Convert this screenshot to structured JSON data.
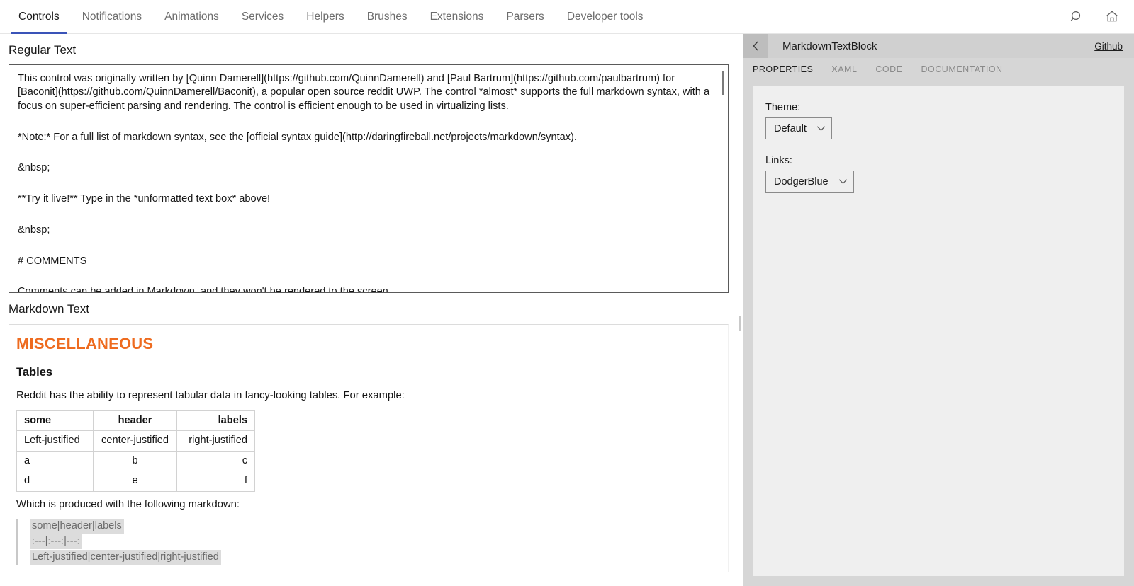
{
  "colors": {
    "accent": "#3a53b8",
    "markdown_heading": "#ee6b1f"
  },
  "topbar": {
    "tabs": [
      {
        "label": "Controls",
        "active": true
      },
      {
        "label": "Notifications",
        "active": false
      },
      {
        "label": "Animations",
        "active": false
      },
      {
        "label": "Services",
        "active": false
      },
      {
        "label": "Helpers",
        "active": false
      },
      {
        "label": "Brushes",
        "active": false
      },
      {
        "label": "Extensions",
        "active": false
      },
      {
        "label": "Parsers",
        "active": false
      },
      {
        "label": "Developer tools",
        "active": false
      }
    ],
    "search_icon": "search-icon",
    "home_icon": "home-icon"
  },
  "left": {
    "regular_text_label": "Regular Text",
    "markdown_text_label": "Markdown Text",
    "editor_paragraphs": [
      "This control was originally written by [Quinn Damerell](https://github.com/QuinnDamerell) and [Paul Bartrum](https://github.com/paulbartrum) for [Baconit](https://github.com/QuinnDamerell/Baconit), a popular open source reddit UWP. The control *almost* supports the full markdown syntax, with a focus on super-efficient parsing and rendering. The control is efficient enough to be used in virtualizing lists.",
      "*Note:* For a full list of markdown syntax, see the [official syntax guide](http://daringfireball.net/projects/markdown/syntax).",
      "&nbsp;",
      "**Try it live!** Type in the *unformatted text box* above!",
      "&nbsp;",
      "# COMMENTS",
      "Comments can be added in Markdown, and they won't be rendered to the screen."
    ],
    "rendered": {
      "h1": "MISCELLANEOUS",
      "h2": "Tables",
      "intro": "Reddit has the ability to represent tabular data in fancy-looking tables. For example:",
      "table": {
        "headers": [
          "some",
          "header",
          "labels"
        ],
        "rows": [
          [
            "Left-justified",
            "center-justified",
            "right-justified"
          ],
          [
            "a",
            "b",
            "c"
          ],
          [
            "d",
            "e",
            "f"
          ]
        ],
        "alignments": [
          "left",
          "center",
          "right"
        ]
      },
      "caption": "Which is produced with the following markdown:",
      "code_lines": [
        "some|header|labels",
        ":---|:---:|---:",
        "Left-justified|center-justified|right-justified"
      ]
    }
  },
  "right": {
    "back_icon": "chevron-left-icon",
    "title": "MarkdownTextBlock",
    "github_link": "Github",
    "tabs": [
      {
        "label": "PROPERTIES",
        "active": true
      },
      {
        "label": "XAML",
        "active": false
      },
      {
        "label": "CODE",
        "active": false
      },
      {
        "label": "DOCUMENTATION",
        "active": false
      }
    ],
    "properties": [
      {
        "label": "Theme:",
        "value": "Default",
        "icon": "chevron-down-icon"
      },
      {
        "label": "Links:",
        "value": "DodgerBlue",
        "icon": "chevron-down-icon"
      }
    ]
  }
}
